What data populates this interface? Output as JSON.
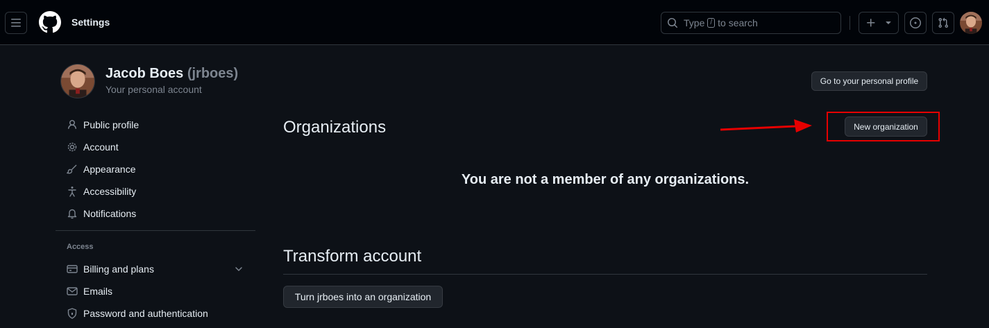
{
  "header": {
    "context_title": "Settings",
    "search": {
      "prefix": "Type",
      "key": "/",
      "suffix": "to search"
    },
    "icons": [
      "three-bars-icon",
      "github-mark-icon",
      "search-icon",
      "plus-icon",
      "triangle-down-icon",
      "issue-opened-icon",
      "git-pull-request-icon",
      "avatar"
    ]
  },
  "user": {
    "name": "Jacob Boes",
    "login": "(jrboes)",
    "subtitle": "Your personal account",
    "profile_button": "Go to your personal profile"
  },
  "sidebar": {
    "items": [
      {
        "label": "Public profile",
        "icon": "person-icon"
      },
      {
        "label": "Account",
        "icon": "gear-icon"
      },
      {
        "label": "Appearance",
        "icon": "paintbrush-icon"
      },
      {
        "label": "Accessibility",
        "icon": "accessibility-icon"
      },
      {
        "label": "Notifications",
        "icon": "bell-icon"
      }
    ],
    "access_group": {
      "label": "Access",
      "items": [
        {
          "label": "Billing and plans",
          "icon": "credit-card-icon",
          "expandable": true
        },
        {
          "label": "Emails",
          "icon": "mail-icon"
        },
        {
          "label": "Password and authentication",
          "icon": "shield-lock-icon"
        }
      ]
    }
  },
  "main": {
    "organizations": {
      "title": "Organizations",
      "new_button": "New organization",
      "empty_message": "You are not a member of any organizations."
    },
    "transform": {
      "title": "Transform account",
      "button": "Turn jrboes into an organization"
    }
  },
  "annotation": {
    "color": "#e60000"
  },
  "colors": {
    "background": "#0d1117",
    "header": "#010409",
    "border": "#30363d",
    "button": "#21262d",
    "muted": "#7d8590",
    "text": "#e6edf3"
  }
}
